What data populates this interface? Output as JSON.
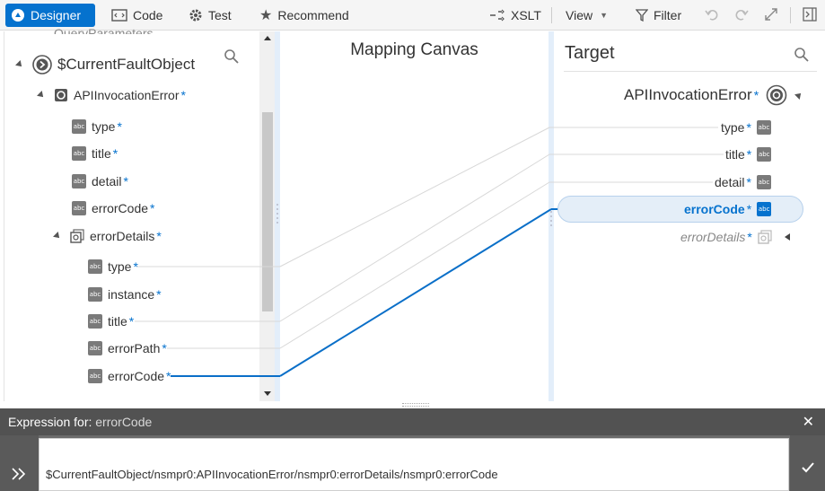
{
  "toolbar": {
    "designer": "Designer",
    "code": "Code",
    "test": "Test",
    "recommend": "Recommend",
    "xslt": "XSLT",
    "view": "View",
    "filter": "Filter"
  },
  "source_tree": {
    "partial_top": "QueryParameters",
    "root": "$CurrentFaultObject",
    "error": "APIInvocationError",
    "fields": [
      "type",
      "title",
      "detail",
      "errorCode"
    ],
    "details": "errorDetails",
    "detail_fields": [
      "type",
      "instance",
      "title",
      "errorPath",
      "errorCode"
    ],
    "required_mark": "*"
  },
  "canvas": {
    "title": "Mapping Canvas"
  },
  "target_tree": {
    "title": "Target",
    "root": "APIInvocationError",
    "fields": [
      "type",
      "title",
      "detail",
      "errorCode"
    ],
    "details": "errorDetails",
    "required_mark": "*"
  },
  "expression": {
    "label": "Expression for:",
    "field": "errorCode",
    "value": "$CurrentFaultObject/nsmpr0:APIInvocationError/nsmpr0:errorDetails/nsmpr0:errorCode"
  },
  "colors": {
    "accent": "#0572ce",
    "mapped_line": "#0a6fc8"
  }
}
